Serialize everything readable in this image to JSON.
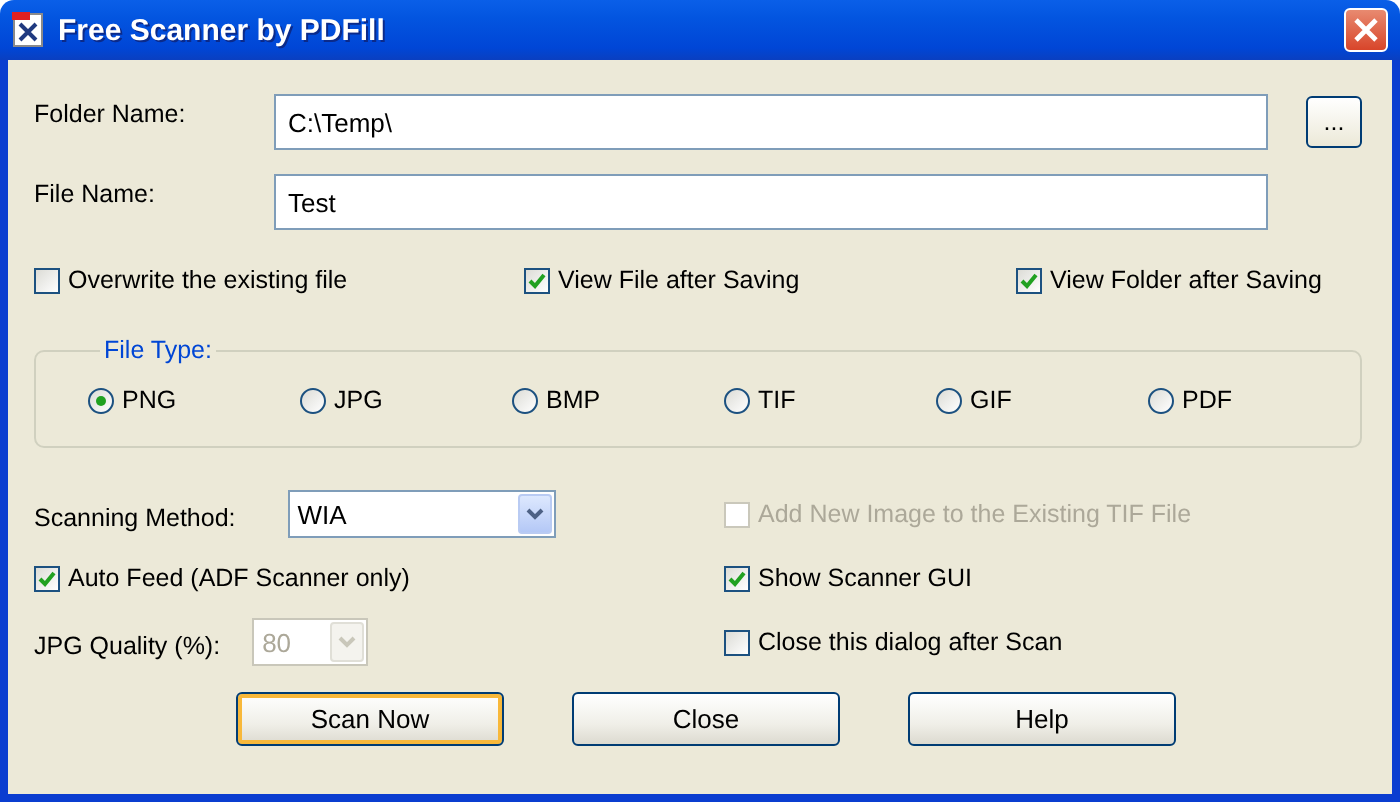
{
  "window": {
    "title": "Free Scanner by PDFill"
  },
  "folder_name": {
    "label": "Folder Name:",
    "value": "C:\\Temp\\"
  },
  "browse_button": {
    "label": "..."
  },
  "file_name": {
    "label": "File Name:",
    "value": "Test"
  },
  "save_options": [
    {
      "label": "Overwrite the existing file",
      "checked": false
    },
    {
      "label": "View File after Saving",
      "checked": true
    },
    {
      "label": "View Folder after Saving",
      "checked": true
    }
  ],
  "file_type": {
    "legend": "File Type:",
    "options": [
      {
        "label": "PNG",
        "selected": true
      },
      {
        "label": "JPG",
        "selected": false
      },
      {
        "label": "BMP",
        "selected": false
      },
      {
        "label": "TIF",
        "selected": false
      },
      {
        "label": "GIF",
        "selected": false
      },
      {
        "label": "PDF",
        "selected": false
      }
    ]
  },
  "scanning_method": {
    "label": "Scanning Method:",
    "value": "WIA"
  },
  "add_to_tif": {
    "label": "Add New Image to the Existing TIF File",
    "checked": false,
    "disabled": true
  },
  "auto_feed": {
    "label": "Auto Feed (ADF Scanner only)",
    "checked": true,
    "disabled": false
  },
  "show_scanner_gui": {
    "label": "Show Scanner GUI",
    "checked": true,
    "disabled": false
  },
  "jpg_quality": {
    "label": "JPG Quality (%):",
    "value": "80",
    "disabled": true
  },
  "close_after_scan": {
    "label": "Close this dialog after Scan",
    "checked": false,
    "disabled": false
  },
  "buttons": [
    {
      "label": "Scan Now",
      "default": true
    },
    {
      "label": "Close",
      "default": false
    },
    {
      "label": "Help",
      "default": false
    }
  ]
}
